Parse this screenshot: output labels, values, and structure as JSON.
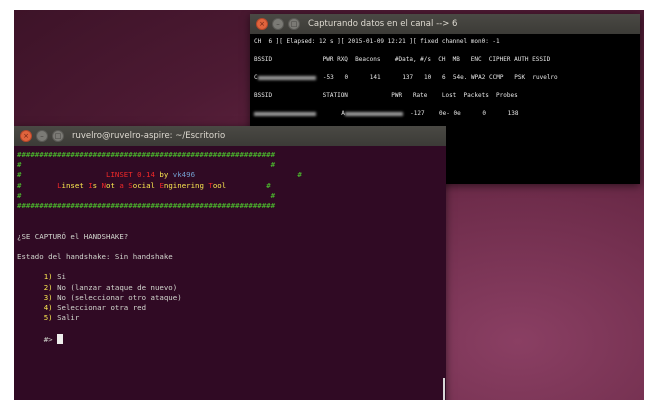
{
  "back_window": {
    "title": "Capturando datos en el canal --> 6",
    "status_line": "CH  6 ][ Elapsed: 12 s ][ 2015-01-09 12:21 ][ fixed channel mon0: -1",
    "ap_header": "BSSID              PWR RXQ  Beacons    #Data, #/s  CH  MB   ENC  CIPHER AUTH ESSID",
    "ap_row_prefix": "C",
    "ap_row": "  -53   0      141      137   10   6  54e. WPA2 CCMP   PSK  ruvelro",
    "client_header": "BSSID              STATION            PWR   Rate    Lost  Packets  Probes",
    "client_row_prefix": "A",
    "client_row": "  -127    0e- 0e      0      138"
  },
  "front_window": {
    "title": "ruvelro@ruvelro-aspire: ~/Escritorio",
    "banner_border": "##########################################################",
    "banner_side": "#",
    "banner_title_name": "LINSET 0.14",
    "banner_title_by": "by",
    "banner_title_author": "vk496",
    "banner_subtitle": [
      {
        "cap": "L",
        "rest": "inset "
      },
      {
        "cap": "I",
        "rest": "s "
      },
      {
        "cap": "N",
        "rest": "ot "
      },
      {
        "cap": "a",
        "rest": " "
      },
      {
        "cap": "S",
        "rest": "ocial "
      },
      {
        "cap": "E",
        "rest": "nginering "
      },
      {
        "cap": "T",
        "rest": "ool"
      }
    ],
    "question": "¿SE CAPTURÓ el HANDSHAKE?",
    "status_label": "Estado del handshake:",
    "status_value": "Sin handshake",
    "options": [
      {
        "num": "1)",
        "label": "Si"
      },
      {
        "num": "2)",
        "label": "No (lanzar ataque de nuevo)"
      },
      {
        "num": "3)",
        "label": "No (seleccionar otro ataque)"
      },
      {
        "num": "4)",
        "label": "Seleccionar otra red"
      },
      {
        "num": "5)",
        "label": "Salir"
      }
    ],
    "prompt": "#>"
  },
  "window_buttons": {
    "close": "×",
    "minimize": "–",
    "maximize": "□"
  },
  "colors": {
    "terminal_bg": "#300a24",
    "banner_green": "#4ec92e",
    "banner_red": "#ef2929",
    "banner_blue": "#729fcf",
    "menu_yellow": "#fce94f"
  }
}
